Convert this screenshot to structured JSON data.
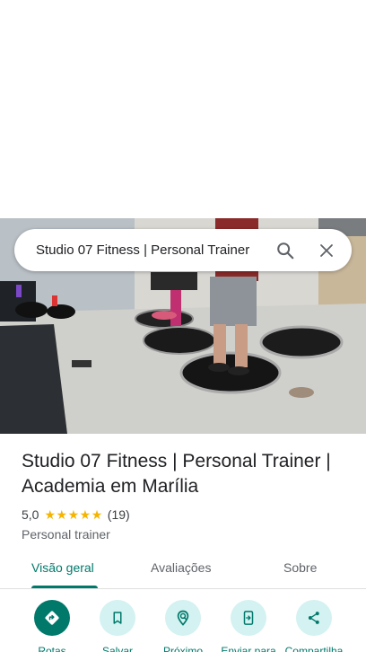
{
  "search": {
    "query": "Studio 07 Fitness | Personal Trainer"
  },
  "place": {
    "name": "Studio 07 Fitness | Personal Trainer | Academia em Marília",
    "rating": "5,0",
    "stars": 5,
    "review_count": "(19)",
    "category": "Personal trainer"
  },
  "tabs": [
    {
      "label": "Visão geral",
      "active": true
    },
    {
      "label": "Avaliações",
      "active": false
    },
    {
      "label": "Sobre",
      "active": false
    }
  ],
  "actions": [
    {
      "label": "Rotas",
      "icon": "directions-icon"
    },
    {
      "label": "Salvar",
      "icon": "bookmark-icon"
    },
    {
      "label": "Próximo",
      "icon": "nearby-icon"
    },
    {
      "label": "Enviar para",
      "icon": "send-to-phone-icon"
    },
    {
      "label": "Compartilha",
      "icon": "share-icon"
    }
  ],
  "colors": {
    "accent": "#00796b",
    "action_bg": "#d3f2f1",
    "star": "#f4b400"
  }
}
